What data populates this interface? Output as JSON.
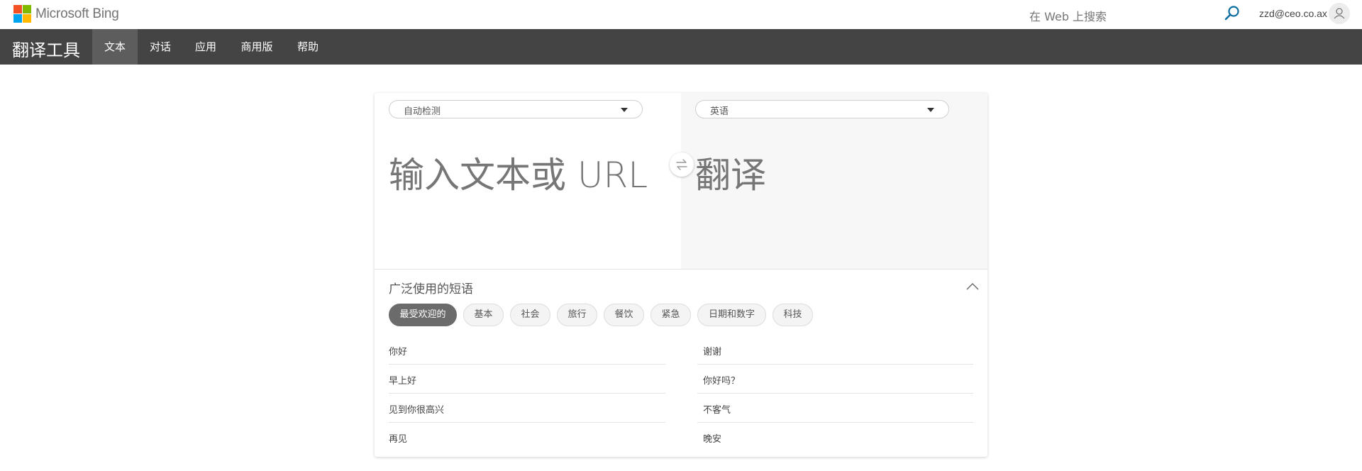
{
  "header": {
    "logo_text": "Microsoft Bing",
    "search_placeholder": "在 Web 上搜索",
    "user_email": "zzd@ceo.co.ax",
    "logo_colors": [
      "#f25022",
      "#7fba00",
      "#00a4ef",
      "#ffb900"
    ]
  },
  "nav": {
    "brand": "翻译工具",
    "items": [
      {
        "label": "文本",
        "active": true
      },
      {
        "label": "对话",
        "active": false
      },
      {
        "label": "应用",
        "active": false
      },
      {
        "label": "商用版",
        "active": false
      },
      {
        "label": "帮助",
        "active": false
      }
    ]
  },
  "translator": {
    "source_language": "自动检测",
    "target_language": "英语",
    "source_placeholder": "输入文本或 URL",
    "target_placeholder": "翻译"
  },
  "phrases": {
    "title": "广泛使用的短语",
    "tabs": [
      {
        "label": "最受欢迎的",
        "active": true
      },
      {
        "label": "基本",
        "active": false
      },
      {
        "label": "社会",
        "active": false
      },
      {
        "label": "旅行",
        "active": false
      },
      {
        "label": "餐饮",
        "active": false
      },
      {
        "label": "紧急",
        "active": false
      },
      {
        "label": "日期和数字",
        "active": false
      },
      {
        "label": "科技",
        "active": false
      }
    ],
    "left": [
      "你好",
      "早上好",
      "见到你很高兴",
      "再见"
    ],
    "right": [
      "谢谢",
      "你好吗？",
      "不客气",
      "晚安"
    ]
  },
  "colors": {
    "nav_bg": "#444444",
    "nav_active": "#5d5d5d",
    "search_icon": "#0c6da0"
  }
}
